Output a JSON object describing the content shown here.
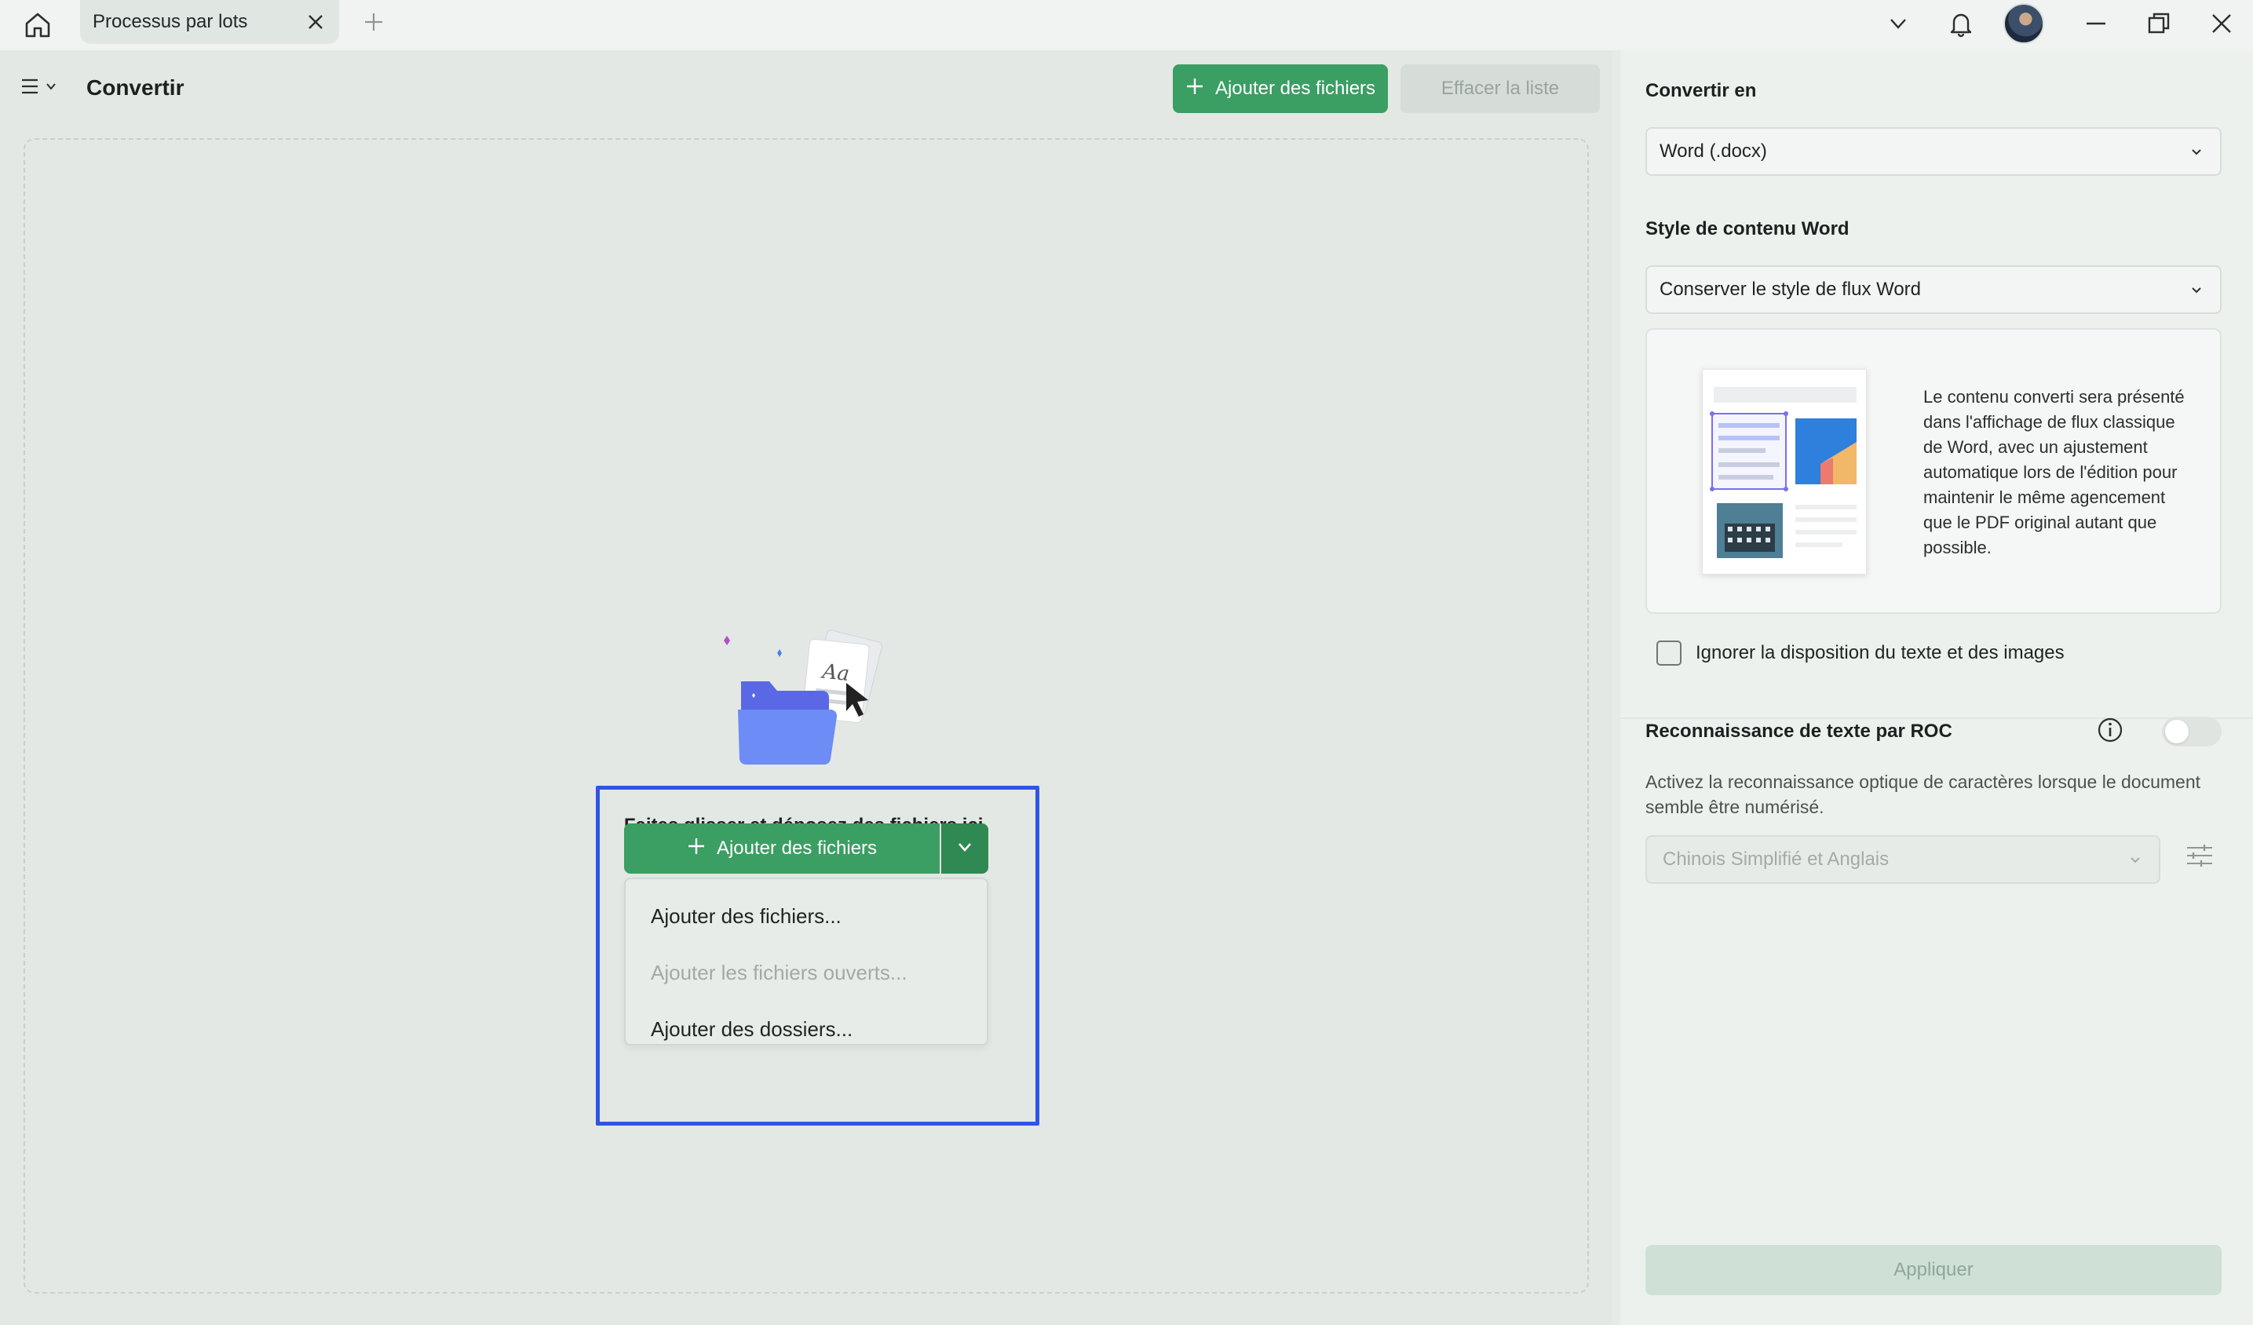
{
  "titlebar": {
    "tab_label": "Processus par lots",
    "icons": [
      "home-icon",
      "close-icon",
      "plus-icon",
      "chevron-down-icon",
      "bell-icon",
      "minimize-icon",
      "restore-icon",
      "close-window-icon"
    ]
  },
  "main": {
    "title": "Convertir",
    "add_files_label": "Ajouter des fichiers",
    "clear_list_label": "Effacer la liste",
    "drop_text": "Faites glisser et déposez des fichiers ici.",
    "split_button_label": "Ajouter des fichiers",
    "dropdown_items": [
      {
        "label": "Ajouter des fichiers...",
        "enabled": true
      },
      {
        "label": "Ajouter les fichiers ouverts...",
        "enabled": false
      },
      {
        "label": "Ajouter des dossiers...",
        "enabled": true
      }
    ]
  },
  "side": {
    "convert_to_heading": "Convertir en",
    "convert_to_value": "Word (.docx)",
    "style_heading": "Style de contenu Word",
    "style_value": "Conserver le style de flux Word",
    "preview_text": "Le contenu converti sera présenté dans l'affichage de flux classique de Word, avec un ajustement automatique lors de l'édition pour maintenir le même agencement que le PDF original autant que possible.",
    "ignore_layout_label": "Ignorer la disposition du texte et des images",
    "ignore_layout_checked": false,
    "ocr_heading": "Reconnaissance de texte par ROC",
    "ocr_enabled": false,
    "ocr_desc": "Activez la reconnaissance optique de caractères lorsque le document semble être numérisé.",
    "ocr_language": "Chinois Simplifié et Anglais",
    "apply_label": "Appliquer"
  },
  "colors": {
    "accent_green": "#3b9e62",
    "highlight_blue": "#2f55e4"
  }
}
